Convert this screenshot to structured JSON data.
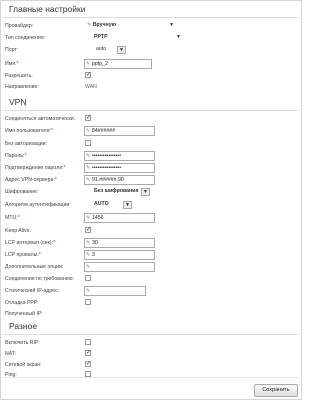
{
  "main_settings": {
    "title": "Главные настройки",
    "provider": {
      "label": "Провайдер:",
      "value": "Вручную"
    },
    "connection_type": {
      "label": "Тип соединения:",
      "value": "PPTP"
    },
    "port": {
      "label": "Порт:",
      "value": "auto"
    },
    "name": {
      "label": "Имя:",
      "value": "pptp_2"
    },
    "allow": {
      "label": "Разрешить:",
      "checked": true
    },
    "direction": {
      "label": "Направление:",
      "value": "WAN"
    }
  },
  "vpn": {
    "title": "VPN",
    "auto_connect": {
      "label": "Соединяться автоматически:",
      "checked": true
    },
    "username": {
      "label": "Имя пользователя:",
      "value": "84######"
    },
    "no_auth": {
      "label": "Без авторизации:",
      "checked": false
    },
    "password": {
      "label": "Пароль:",
      "value": "••••••••••••••••"
    },
    "password_confirm": {
      "label": "Подтверждение пароля:",
      "value": "••••••••••••••••"
    },
    "server": {
      "label": "Адрес VPN-сервера:",
      "value": "91.######.90"
    },
    "encryption": {
      "label": "Шифрование:",
      "value": "Без шифрования"
    },
    "auth_algorithm": {
      "label": "Алгоритм аутентификации:",
      "value": "AUTO"
    },
    "mtu": {
      "label": "MTU:",
      "value": "1456"
    },
    "keep_alive": {
      "label": "Keep Alive:",
      "checked": true
    },
    "lcp_interval": {
      "label": "LCP интервал (сек):",
      "value": "30"
    },
    "lcp_failures": {
      "label": "LCP провалы:",
      "value": "3"
    },
    "extra_options": {
      "label": "Дополнительные опции:",
      "value": ""
    },
    "on_demand": {
      "label": "Соединение по требованию:",
      "checked": false
    },
    "static_ip": {
      "label": "Статический IP-адрес:",
      "value": ""
    },
    "ppp_debug": {
      "label": "Отладка PPP:",
      "checked": false
    },
    "remote_ip": {
      "label": "Полученный IP:",
      "value": ""
    }
  },
  "misc": {
    "title": "Разное",
    "rip": {
      "label": "Включить RIP:",
      "checked": false
    },
    "nat": {
      "label": "NAT:",
      "checked": true
    },
    "firewall": {
      "label": "Сетевой экран:",
      "checked": true
    },
    "ping": {
      "label": "Ping:",
      "checked": false
    }
  },
  "buttons": {
    "save": "Сохранить"
  },
  "icons": {
    "pencil": "pencil-icon",
    "check": "✓",
    "dropdown": "▼"
  },
  "colors": {
    "required": "#d62020",
    "border": "#aaaaaa"
  }
}
